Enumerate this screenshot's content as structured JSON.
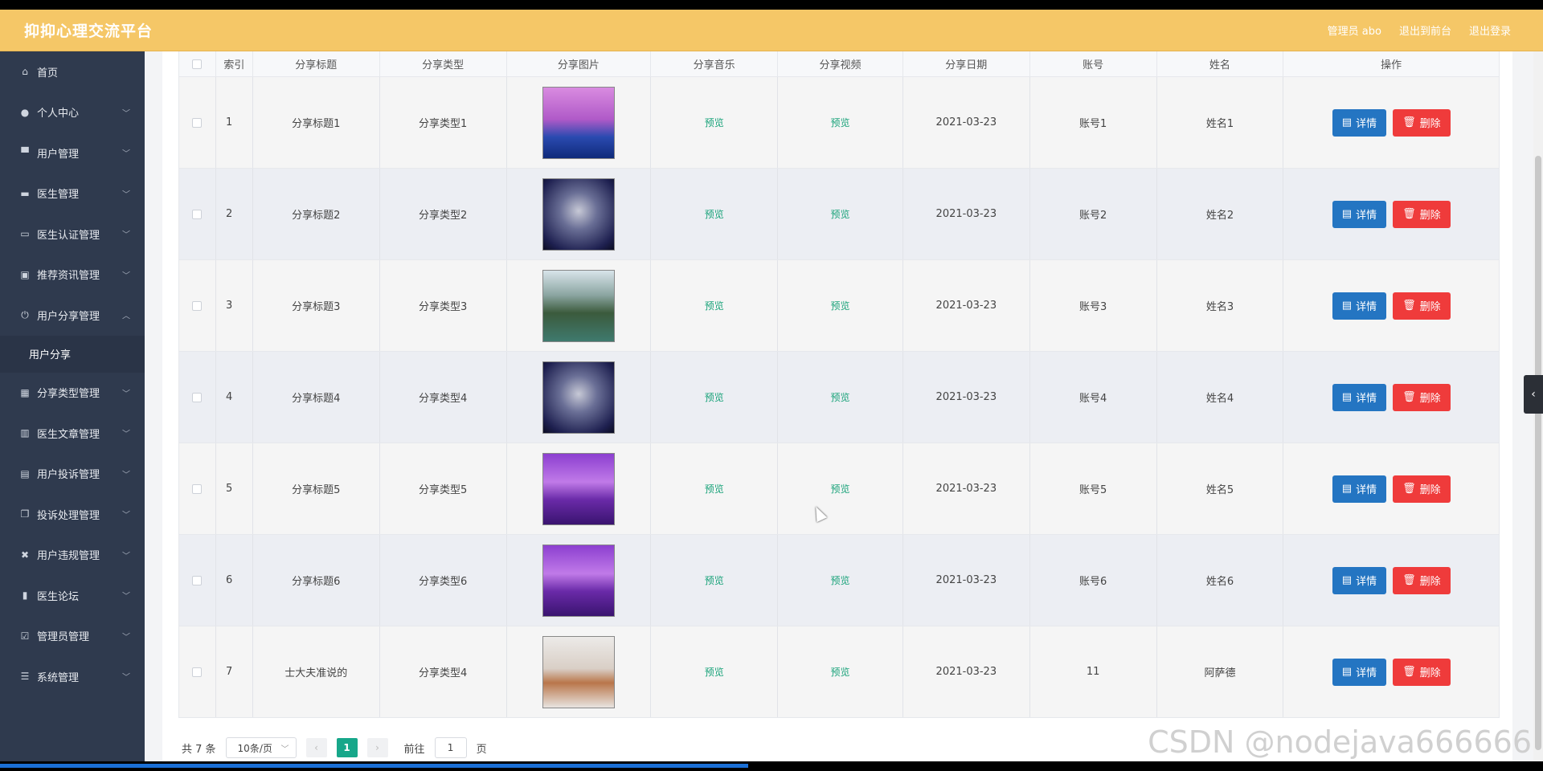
{
  "header": {
    "title": "抑抑心理交流平台",
    "admin": "管理员 abo",
    "back_front": "退出到前台",
    "logout": "退出登录"
  },
  "sidebar": {
    "items": [
      {
        "label": "首页",
        "icon": "home-icon"
      },
      {
        "label": "个人中心",
        "icon": "user-icon"
      },
      {
        "label": "用户管理",
        "icon": "users-icon"
      },
      {
        "label": "医生管理",
        "icon": "monitor-icon"
      },
      {
        "label": "医生认证管理",
        "icon": "card-icon"
      },
      {
        "label": "推荐资讯管理",
        "icon": "clipboard-icon"
      },
      {
        "label": "用户分享管理",
        "icon": "power-icon"
      },
      {
        "label": "分享类型管理",
        "icon": "grid-icon"
      },
      {
        "label": "医生文章管理",
        "icon": "chart-icon"
      },
      {
        "label": "用户投诉管理",
        "icon": "message-icon"
      },
      {
        "label": "投诉处理管理",
        "icon": "copy-icon"
      },
      {
        "label": "用户违规管理",
        "icon": "ban-icon"
      },
      {
        "label": "医生论坛",
        "icon": "forum-icon"
      },
      {
        "label": "管理员管理",
        "icon": "check-icon"
      },
      {
        "label": "系统管理",
        "icon": "sliders-icon"
      }
    ],
    "sub_item": "用户分享"
  },
  "table": {
    "columns": [
      "索引",
      "分享标题",
      "分享类型",
      "分享图片",
      "分享音乐",
      "分享视频",
      "分享日期",
      "账号",
      "姓名",
      "操作"
    ],
    "preview_label": "预览",
    "detail_label": "详情",
    "delete_label": "删除",
    "rows": [
      {
        "index": "1",
        "title": "分享标题1",
        "type": "分享类型1",
        "date": "2021-03-23",
        "account": "账号1",
        "name": "姓名1"
      },
      {
        "index": "2",
        "title": "分享标题2",
        "type": "分享类型2",
        "date": "2021-03-23",
        "account": "账号2",
        "name": "姓名2"
      },
      {
        "index": "3",
        "title": "分享标题3",
        "type": "分享类型3",
        "date": "2021-03-23",
        "account": "账号3",
        "name": "姓名3"
      },
      {
        "index": "4",
        "title": "分享标题4",
        "type": "分享类型4",
        "date": "2021-03-23",
        "account": "账号4",
        "name": "姓名4"
      },
      {
        "index": "5",
        "title": "分享标题5",
        "type": "分享类型5",
        "date": "2021-03-23",
        "account": "账号5",
        "name": "姓名5"
      },
      {
        "index": "6",
        "title": "分享标题6",
        "type": "分享类型6",
        "date": "2021-03-23",
        "account": "账号6",
        "name": "姓名6"
      },
      {
        "index": "7",
        "title": "士大夫准说的",
        "type": "分享类型4",
        "date": "2021-03-23",
        "account": "11",
        "name": "阿萨德"
      }
    ]
  },
  "pagination": {
    "total": "共 7 条",
    "page_size": "10条/页",
    "current_page": "1",
    "goto_prefix": "前往",
    "goto_value": "1",
    "goto_suffix": "页"
  },
  "watermark": "CSDN @nodejava666666",
  "colors": {
    "header": "#f5c767",
    "sidebar": "#2f3a4e",
    "accent": "#17a78a",
    "detail": "#2475c2",
    "delete": "#ef3b3b"
  },
  "video_progress": 0.485
}
